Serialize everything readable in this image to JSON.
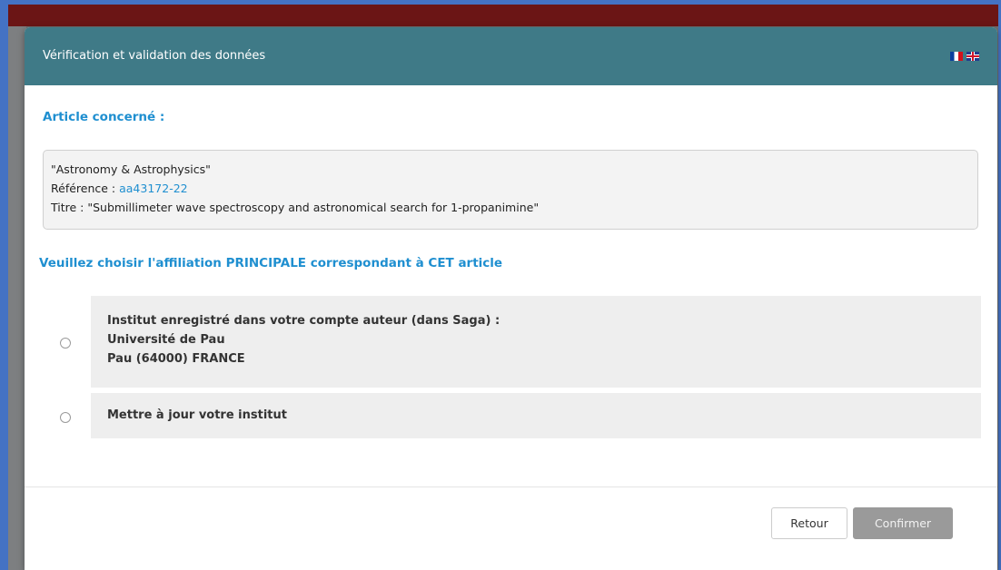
{
  "modal": {
    "title": "Vérification et validation des données",
    "languages": [
      "fr-flag-icon",
      "uk-flag-icon"
    ]
  },
  "article": {
    "section_title": "Article concerné :",
    "journal": "\"Astronomy & Astrophysics\"",
    "reference_label": "Référence : ",
    "reference_value": "aa43172-22",
    "title_line": "Titre : \"Submillimeter wave spectroscopy and astronomical search for 1-propanimine\""
  },
  "affiliation": {
    "section_title": "Veuillez choisir l'affiliation PRINCIPALE correspondant à CET article",
    "options": [
      {
        "line1": "Institut enregistré dans votre compte auteur (dans Saga) :",
        "line2": "Université de Pau",
        "line3": "Pau (64000) FRANCE",
        "selected": false
      },
      {
        "line1": "Mettre à jour votre institut",
        "selected": false
      }
    ]
  },
  "footer": {
    "back_label": "Retour",
    "confirm_label": "Confirmer"
  },
  "colors": {
    "header_bg": "#3f7a87",
    "accent_text": "#1f8fd0",
    "confirm_disabled": "#9a9a9a",
    "frame": "#4472c4"
  }
}
